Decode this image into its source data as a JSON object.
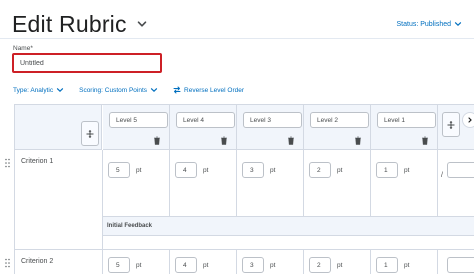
{
  "header": {
    "title": "Edit Rubric",
    "status_label": "Status: Published"
  },
  "name_field": {
    "label": "Name*",
    "value": "Untitled"
  },
  "toolbar": {
    "type_label": "Type: Analytic",
    "scoring_label": "Scoring: Custom Points",
    "reverse_label": "Reverse Level Order"
  },
  "levels": [
    "Level 5",
    "Level 4",
    "Level 3",
    "Level 2",
    "Level 1"
  ],
  "criteria": [
    {
      "name": "Criterion 1",
      "points": [
        "5",
        "4",
        "3",
        "2",
        "1"
      ],
      "feedback_label": "Initial Feedback"
    },
    {
      "name": "Criterion 2",
      "points": [
        "5",
        "4",
        "3",
        "2",
        "1"
      ]
    }
  ],
  "unit_label": "pt",
  "slash": "/",
  "colors": {
    "accent": "#006fbf",
    "error_border": "#cd2026",
    "header_bg": "#f1f5fb"
  }
}
